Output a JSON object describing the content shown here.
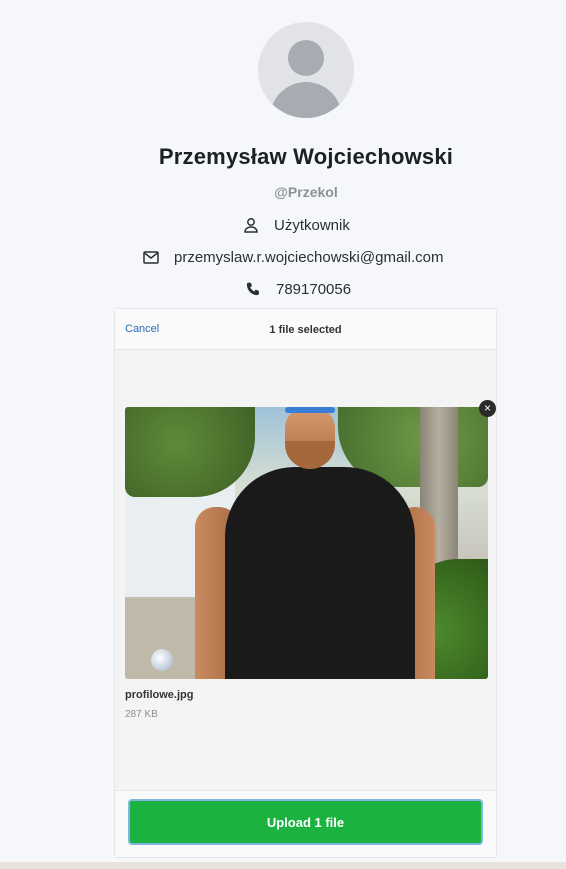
{
  "profile": {
    "name": "Przemysław Wojciechowski",
    "handle": "@Przekol",
    "role": "Użytkownik",
    "email": "przemyslaw.r.wojciechowski@gmail.com",
    "phone": "789170056",
    "icons": [
      "user-icon",
      "envelope-icon",
      "phone-icon"
    ]
  },
  "uploader": {
    "cancel_label": "Cancel",
    "status": "1 file selected",
    "file": {
      "name": "profilowe.jpg",
      "size": "287 KB"
    },
    "remove_label": "×",
    "upload_label": "Upload 1 file"
  },
  "colors": {
    "accent": "#1bb240",
    "link": "#2a6ab3"
  }
}
